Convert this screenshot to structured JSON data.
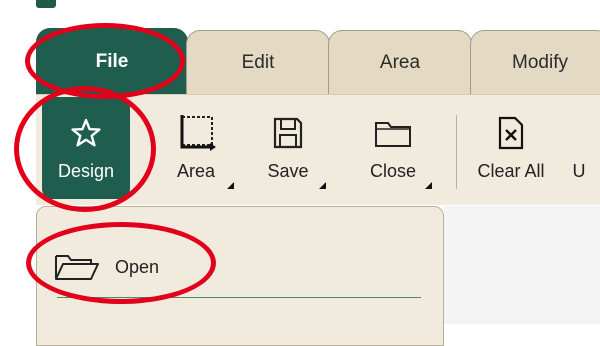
{
  "tabs": [
    {
      "label": "File",
      "active": true
    },
    {
      "label": "Edit",
      "active": false
    },
    {
      "label": "Area",
      "active": false
    },
    {
      "label": "Modify",
      "active": false
    }
  ],
  "ribbon": {
    "buttons": [
      {
        "label": "Design",
        "icon": "star-outline-icon",
        "active": true
      },
      {
        "label": "Area",
        "icon": "area-select-icon",
        "dropdown": true
      },
      {
        "label": "Save",
        "icon": "floppy-disk-icon",
        "dropdown": true
      },
      {
        "label": "Close",
        "icon": "folder-icon",
        "dropdown": true
      },
      {
        "label": "Clear All",
        "icon": "clear-document-icon"
      },
      {
        "label": "U",
        "icon": ""
      }
    ]
  },
  "file_menu": {
    "items": [
      {
        "label": "Open",
        "icon": "folder-open-icon"
      }
    ]
  },
  "colors": {
    "accent": "#1f5e4e",
    "annotation": "#e3001b",
    "ribbon_bg": "#f1ebdd",
    "tab_bg": "#e4dac4"
  }
}
